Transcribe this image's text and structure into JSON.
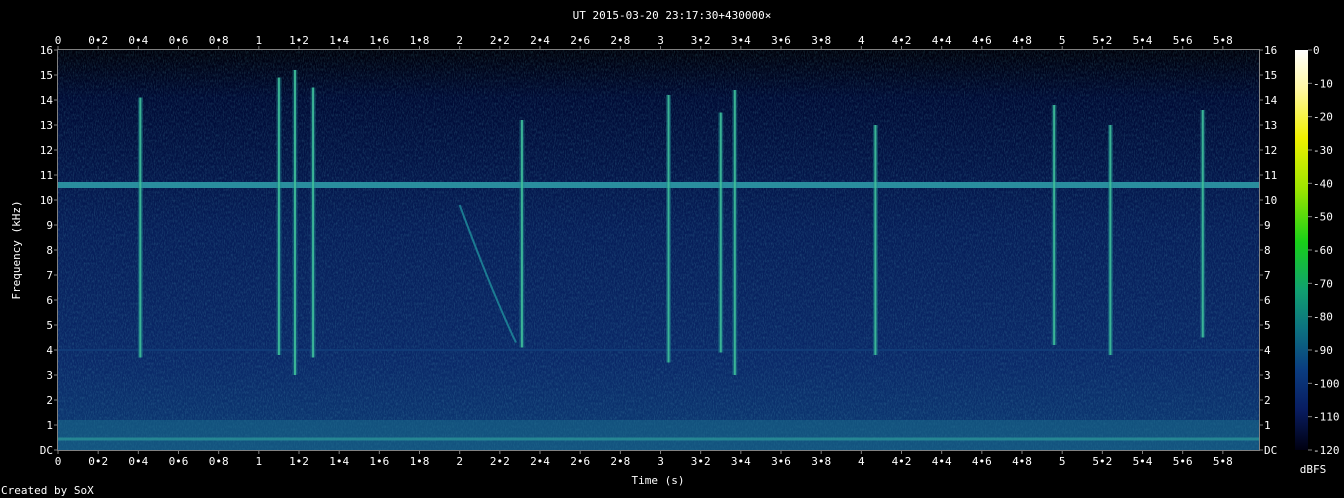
{
  "chart_data": {
    "type": "heatmap",
    "title": "UT 2015-03-20 23:17:30+430000×",
    "xlabel": "Time (s)",
    "ylabel": "Frequency (kHz)",
    "xlim": [
      0,
      5.98
    ],
    "ylim": [
      0,
      16
    ],
    "x_ticks": [
      "0",
      "0•2",
      "0•4",
      "0•6",
      "0•8",
      "1",
      "1•2",
      "1•4",
      "1•6",
      "1•8",
      "2",
      "2•2",
      "2•4",
      "2•6",
      "2•8",
      "3",
      "3•2",
      "3•4",
      "3•6",
      "3•8",
      "4",
      "4•2",
      "4•4",
      "4•6",
      "4•8",
      "5",
      "5•2",
      "5•4",
      "5•6",
      "5•8"
    ],
    "y_ticks": [
      "DC",
      "1",
      "2",
      "3",
      "4",
      "5",
      "6",
      "7",
      "8",
      "9",
      "10",
      "11",
      "12",
      "13",
      "14",
      "15",
      "16"
    ],
    "colorbar": {
      "label": "dBFS",
      "range": [
        -120,
        0
      ],
      "ticks": [
        "0",
        "-10",
        "-20",
        "-30",
        "-40",
        "-50",
        "-60",
        "-70",
        "-80",
        "-90",
        "-100",
        "-110",
        "-120"
      ]
    },
    "colors": {
      "background": "#000000",
      "low": "#000010",
      "mid": "#0a2a6a",
      "high": "#40c8a0",
      "peak": "#ffffff"
    },
    "features": {
      "constant_tone_khz": 10.6,
      "band_limit_khz": 4.0,
      "sweep": {
        "t_start": 2.0,
        "f_start_khz": 9.8,
        "t_end": 2.28,
        "f_end_khz": 4.3
      },
      "transients": [
        {
          "t": 0.41,
          "f_low_khz": 3.7,
          "f_high_khz": 14.1
        },
        {
          "t": 1.1,
          "f_low_khz": 3.8,
          "f_high_khz": 14.9
        },
        {
          "t": 1.18,
          "f_low_khz": 3.0,
          "f_high_khz": 15.2
        },
        {
          "t": 1.27,
          "f_low_khz": 3.7,
          "f_high_khz": 14.5
        },
        {
          "t": 2.31,
          "f_low_khz": 4.1,
          "f_high_khz": 13.2
        },
        {
          "t": 3.04,
          "f_low_khz": 3.5,
          "f_high_khz": 14.2
        },
        {
          "t": 3.3,
          "f_low_khz": 3.9,
          "f_high_khz": 13.5
        },
        {
          "t": 3.37,
          "f_low_khz": 3.0,
          "f_high_khz": 14.4
        },
        {
          "t": 4.07,
          "f_low_khz": 3.8,
          "f_high_khz": 13.0
        },
        {
          "t": 4.96,
          "f_low_khz": 4.2,
          "f_high_khz": 13.8
        },
        {
          "t": 5.24,
          "f_low_khz": 3.8,
          "f_high_khz": 13.0
        },
        {
          "t": 5.7,
          "f_low_khz": 4.5,
          "f_high_khz": 13.6
        }
      ]
    }
  },
  "footer": {
    "credit": "Created by SoX"
  }
}
